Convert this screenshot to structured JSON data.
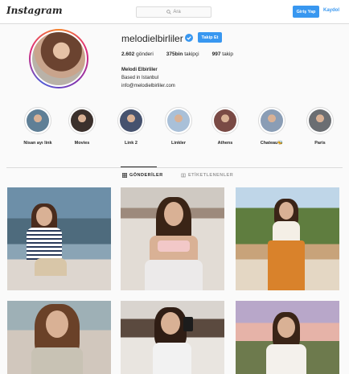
{
  "topbar": {
    "logo": "Instagram",
    "search_placeholder": "Ara",
    "login_label": "Giriş Yap",
    "signup_label": "Kaydol"
  },
  "profile": {
    "username": "melodielbirliler",
    "follow_label": "Takip Et",
    "stats": {
      "posts_count": "2.602",
      "posts_label": "gönderi",
      "followers_count": "375bin",
      "followers_label": "takipçi",
      "following_count": "997",
      "following_label": "takip"
    },
    "full_name": "Melodi Elbirliler",
    "bio_line": "Based in Istanbul",
    "email": "info@melodielbirliler.com"
  },
  "highlights": [
    {
      "label": "Nisan ayı link",
      "color": "#5f7f96"
    },
    {
      "label": "Movies",
      "color": "#3b302c"
    },
    {
      "label": "Link 2",
      "color": "#46526e"
    },
    {
      "label": "Linkler",
      "color": "#a9c0d8"
    },
    {
      "label": "Athens",
      "color": "#7a4a45"
    },
    {
      "label": "Chateau🐝",
      "color": "#8a9db5"
    },
    {
      "label": "Paris",
      "color": "#6b6e72"
    }
  ],
  "tabs": {
    "posts_label": "GÖNDERİLER",
    "tagged_label": "ETİKETLENENLER"
  },
  "colors": {
    "accent": "#3897f0",
    "text": "#262626",
    "muted": "#8e8e8e",
    "border": "#dbdbdb"
  }
}
